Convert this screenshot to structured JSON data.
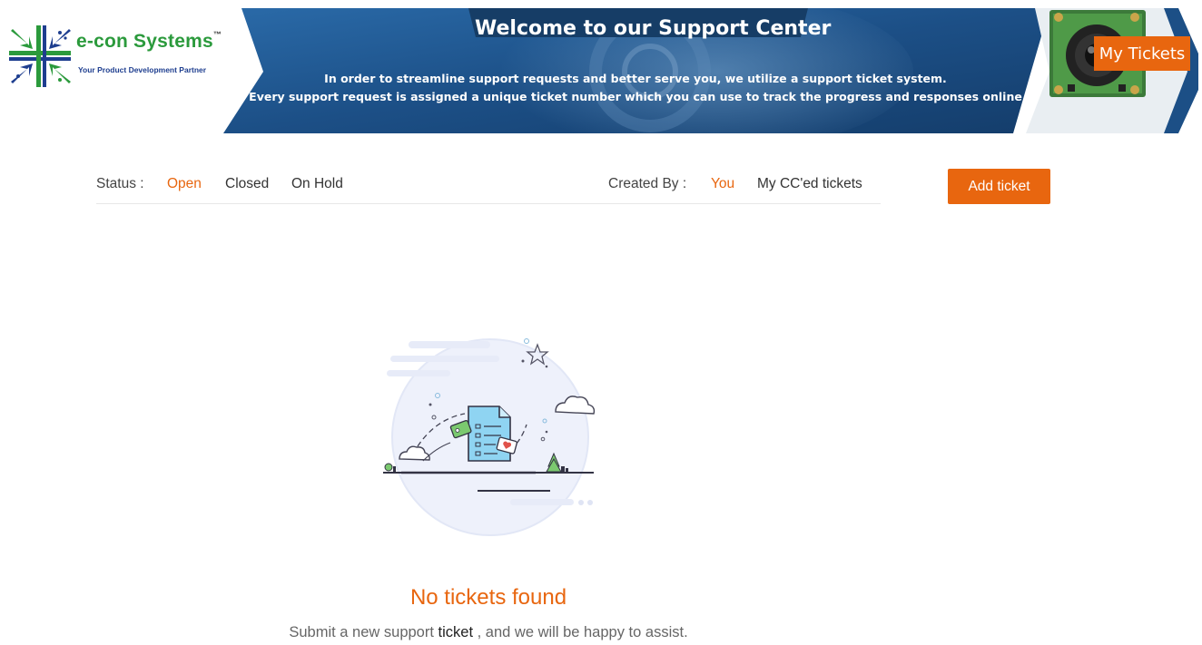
{
  "brand": {
    "name": "e-con Systems",
    "trademark": "™",
    "tagline": "Your Product Development Partner"
  },
  "banner": {
    "title": "Welcome to our Support Center",
    "line1": "In order to streamline support requests and better serve you, we utilize a support ticket system.",
    "line2": "Every support request is assigned a unique ticket number which you can use to track the progress and responses online"
  },
  "header": {
    "my_tickets_label": "My Tickets"
  },
  "filters": {
    "status_label": "Status :",
    "status_options": [
      "Open",
      "Closed",
      "On Hold"
    ],
    "status_selected": "Open",
    "created_by_label": "Created By :",
    "created_by_options": [
      "You",
      "My CC'ed tickets"
    ],
    "created_by_selected": "You"
  },
  "actions": {
    "add_ticket_label": "Add ticket"
  },
  "empty_state": {
    "title": "No tickets found",
    "message_before": "Submit a new support ",
    "message_link": "ticket",
    "message_after": " , and we will be happy to assist."
  },
  "colors": {
    "accent": "#e8660f",
    "brand_green": "#2b9a3c",
    "brand_blue": "#1e3e8f",
    "banner_blue": "#1c4f86"
  },
  "icons": {
    "logo": "e-con-logo-icon",
    "camera": "camera-module-icon",
    "illustration": "empty-tickets-illustration"
  }
}
